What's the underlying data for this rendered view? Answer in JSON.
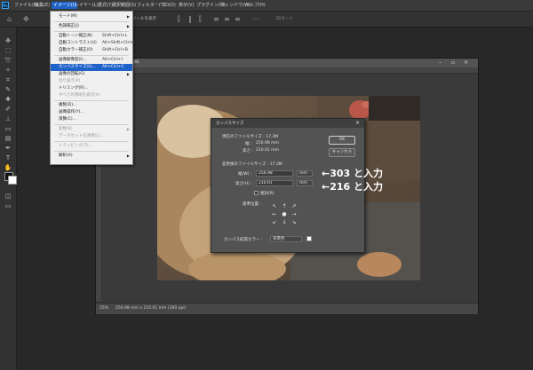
{
  "menubar": {
    "app_icon": "Ps",
    "items": [
      "ファイル(F)",
      "編集(E)",
      "イメージ(I)",
      "レイヤー(L)",
      "書式(Y)",
      "選択範囲(S)",
      "フィルター(T)",
      "3D(D)",
      "表示(V)",
      "プラグイン(N)",
      "ウィンドウ(W)",
      "ヘルプ(H)"
    ],
    "active_item": "イメージ(I)"
  },
  "optionsbar": {
    "home_icon": "home-icon",
    "move_icon": "move-icon",
    "text_fragment": "ツールを表示",
    "mode_text": "3Dモード"
  },
  "image_menu": {
    "items": [
      {
        "label": "モード(M)",
        "shortcut": "",
        "submenu": true,
        "disabled": false,
        "highlight": false
      },
      {
        "sep": true
      },
      {
        "label": "色調補正(J)",
        "shortcut": "",
        "submenu": true,
        "disabled": false,
        "highlight": false
      },
      {
        "sep": true
      },
      {
        "label": "自動トーン補正(N)",
        "shortcut": "Shift+Ctrl+L",
        "submenu": false,
        "disabled": false,
        "highlight": false
      },
      {
        "label": "自動コントラスト(U)",
        "shortcut": "Alt+Shift+Ctrl+L",
        "submenu": false,
        "disabled": false,
        "highlight": false
      },
      {
        "label": "自動カラー補正(O)",
        "shortcut": "Shift+Ctrl+B",
        "submenu": false,
        "disabled": false,
        "highlight": false
      },
      {
        "sep": true
      },
      {
        "label": "画像解像度(I)...",
        "shortcut": "Alt+Ctrl+I",
        "submenu": false,
        "disabled": false,
        "highlight": false
      },
      {
        "label": "カンバスサイズ(S)...",
        "shortcut": "Alt+Ctrl+C",
        "submenu": false,
        "disabled": false,
        "highlight": true
      },
      {
        "label": "画像の回転(G)",
        "shortcut": "",
        "submenu": true,
        "disabled": false,
        "highlight": false
      },
      {
        "label": "切り抜き(P)",
        "shortcut": "",
        "submenu": false,
        "disabled": true,
        "highlight": false
      },
      {
        "label": "トリミング(R)...",
        "shortcut": "",
        "submenu": false,
        "disabled": false,
        "highlight": false
      },
      {
        "label": "すべての領域を表示(V)",
        "shortcut": "",
        "submenu": false,
        "disabled": true,
        "highlight": false
      },
      {
        "sep": true
      },
      {
        "label": "複製(D)...",
        "shortcut": "",
        "submenu": false,
        "disabled": false,
        "highlight": false
      },
      {
        "label": "画像操作(Y)...",
        "shortcut": "",
        "submenu": false,
        "disabled": false,
        "highlight": false
      },
      {
        "label": "演算(C)...",
        "shortcut": "",
        "submenu": false,
        "disabled": false,
        "highlight": false
      },
      {
        "sep": true
      },
      {
        "label": "変数(B)",
        "shortcut": "",
        "submenu": true,
        "disabled": true,
        "highlight": false
      },
      {
        "label": "データセットを適用(L)...",
        "shortcut": "",
        "submenu": false,
        "disabled": true,
        "highlight": false
      },
      {
        "sep": true
      },
      {
        "label": "トラッピング(T)...",
        "shortcut": "",
        "submenu": false,
        "disabled": true,
        "highlight": false
      },
      {
        "sep": true
      },
      {
        "label": "解析(A)",
        "shortcut": "",
        "submenu": true,
        "disabled": false,
        "highlight": false
      }
    ]
  },
  "document": {
    "title": "... @ 25% (RGB/8)",
    "zoom": "25%",
    "status": "256.98 mm x 210.01 mm (300 ppi)"
  },
  "canvas_dialog": {
    "title": "カンバスサイズ",
    "current_size_label": "現在のファイルサイズ : 17.3M",
    "current_width_label": "幅 :",
    "current_width_value": "256.98 mm",
    "current_height_label": "高さ :",
    "current_height_value": "210.01 mm",
    "new_size_label": "変更後のファイルサイズ : 17.3M",
    "width_label": "幅(W) :",
    "width_value": "256.98",
    "width_unit": "mm",
    "height_label": "高さ(H) :",
    "height_value": "210.01",
    "height_unit": "mm",
    "relative_label": "相対(R)",
    "anchor_label": "基準位置 :",
    "ext_color_label": "カンバス拡張カラー :",
    "ext_color_value": "背景色",
    "ok_label": "OK",
    "cancel_label": "キャンセル"
  },
  "annotations": {
    "width_note": "←303 と入力",
    "height_note": "←216 と入力"
  }
}
